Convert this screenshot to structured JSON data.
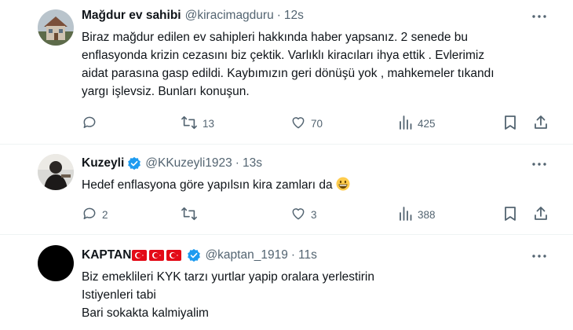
{
  "tweets": [
    {
      "name": "Mağdur ev sahibi",
      "handle": "@kiracimagduru",
      "separator": "·",
      "time": "12s",
      "lines": [
        "Biraz mağdur edilen ev sahipleri hakkında haber yapsanız. 2 senede bu",
        "enflasyonda krizin cezasını biz çektik. Varlıklı kiracıları ihya ettik . Evlerimiz",
        "aidat parasına gasp edildi. Kaybımızın geri dönüşü yok , mahkemeler tıkandı",
        "yargı işlevsiz. Bunları konuşun."
      ],
      "replies": "",
      "retweets": "13",
      "likes": "70",
      "views": "425"
    },
    {
      "name": "Kuzeyli",
      "handle": "@KKuzeyli1923",
      "separator": "·",
      "time": "13s",
      "verified": true,
      "lines": [
        "Hedef enflasyona göre yapılsın kira zamları da"
      ],
      "emoji": "grinning-face",
      "replies": "2",
      "retweets": "",
      "likes": "3",
      "views": "388"
    },
    {
      "name": "KAPTAN",
      "handle": "@kaptan_1919",
      "separator": "·",
      "time": "11s",
      "verified": true,
      "flags": [
        "turkey-flag-icon",
        "turkey-flag-icon",
        "turkey-flag-icon"
      ],
      "lines": [
        "Biz emeklileri KYK tarzı yurtlar yapip oralara yerlestirin",
        "Istiyenleri tabi",
        "Bari sokakta kalmiyalim"
      ]
    }
  ],
  "colors": {
    "text": "#0f1419",
    "secondary": "#536471",
    "verified_blue": "#1d9bf0",
    "divider": "#eff3f4",
    "flag_red": "#e30a17"
  }
}
